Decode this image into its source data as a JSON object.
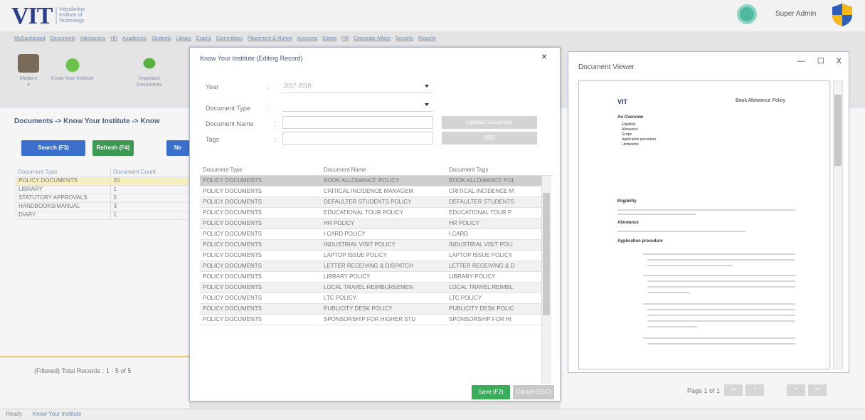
{
  "header": {
    "logo_text": "VIT",
    "logo_sub": [
      "Vidyalankar",
      "Institute of",
      "Technology"
    ],
    "user_name": "Super Admin"
  },
  "menu": [
    "MyDashboard",
    "Documents",
    "Admissions",
    "HR",
    "Academics",
    "Students",
    "Library",
    "Exams",
    "Committees",
    "Placement & Alumni",
    "Accounts",
    "Stores",
    "FM",
    "Corporate Affairs",
    "Security",
    "Reports"
  ],
  "ribbon": [
    {
      "label": "Masters",
      "sub": "▾",
      "icon": "masters-icon"
    },
    {
      "label": "Know Your Institute",
      "icon": "globe-icon"
    },
    {
      "label": "Important Documents",
      "icon": "leaf-icon"
    }
  ],
  "left": {
    "breadcrumb": "Documents -> Know Your Institute -> Know",
    "search_label": "Search (F3)",
    "refresh_label": "Refresh (F4)",
    "new_label": "Ne",
    "table_headers": [
      "Document Type",
      "Document Count"
    ],
    "rows": [
      {
        "type": "POLICY DOCUMENTS",
        "count": "20"
      },
      {
        "type": "LIBRARY",
        "count": "1"
      },
      {
        "type": "STATUTORY APPROVALS",
        "count": "5"
      },
      {
        "type": "HANDBOOKS/MANUAL",
        "count": "3"
      },
      {
        "type": "DIARY",
        "count": "1"
      }
    ],
    "total_records": "(Filtered) Total Records : 1 - 5 of 5"
  },
  "status": {
    "ready": "Ready",
    "page": "Know Your Institute"
  },
  "modal": {
    "title": "Know Your Institute (Editing Record)",
    "close": "×",
    "year_label": "Year",
    "year_value": "2017-2018",
    "doctype_label": "Document Type",
    "docname_label": "Document Name",
    "tags_label": "Tags",
    "colon": ":",
    "upload_label": "Upload Document",
    "add_label": "ADD",
    "grid_headers": [
      "Document Type",
      "Document Name",
      "Document Tags"
    ],
    "grid_rows": [
      {
        "type": "POLICY DOCUMENTS",
        "name": "BOOK ALLOWANCE POLICY",
        "tags": "BOOK ALLOWANCE POL"
      },
      {
        "type": "POLICY DOCUMENTS",
        "name": "CRITICAL INCIDENCE MANAGEM",
        "tags": "CRITICAL INCIDENCE M"
      },
      {
        "type": "POLICY DOCUMENTS",
        "name": "DEFAULTER STUDENTS POLICY",
        "tags": "DEFAULTER STUDENTS"
      },
      {
        "type": "POLICY DOCUMENTS",
        "name": "EDUCATIONAL TOUR POLICY",
        "tags": "EDUCATIONAL TOUR P"
      },
      {
        "type": "POLICY DOCUMENTS",
        "name": "HR POLICY",
        "tags": "HR POLICY"
      },
      {
        "type": "POLICY DOCUMENTS",
        "name": "I CARD POLICY",
        "tags": "I CARD"
      },
      {
        "type": "POLICY DOCUMENTS",
        "name": "INDUSTRIAL VISIT POLICY",
        "tags": "INDUSTRIAL VISIT POLI"
      },
      {
        "type": "POLICY DOCUMENTS",
        "name": "LAPTOP ISSUE POLICY",
        "tags": "LAPTOP ISSUE POLICY"
      },
      {
        "type": "POLICY DOCUMENTS",
        "name": "LETTER RECEIVING & DISPATCH",
        "tags": "LETTER RECEIVING & D"
      },
      {
        "type": "POLICY DOCUMENTS",
        "name": "LIBRARY POLICY",
        "tags": "LIBRARY POLICY"
      },
      {
        "type": "POLICY DOCUMENTS",
        "name": "LOCAL TRAVEL REIMBURSEMEN",
        "tags": "LOCAL TRAVEL REIMBL"
      },
      {
        "type": "POLICY DOCUMENTS",
        "name": "LTC POLICY",
        "tags": "LTC POLICY"
      },
      {
        "type": "POLICY DOCUMENTS",
        "name": "PUBLICITY DESK POLICY",
        "tags": "PUBLICITY DESK POLIC"
      },
      {
        "type": "POLICY DOCUMENTS",
        "name": "SPONSORSHIP FOR HIGHER STU",
        "tags": "SPONSORSHIP FOR HI"
      }
    ],
    "save_label": "Save (F2)",
    "cancel_label": "Cancel (ESC)"
  },
  "viewer": {
    "title": "Document Viewer",
    "minimize": "—",
    "maximize": "☐",
    "close": "X",
    "doc": {
      "logo": "VIT",
      "title": "Book Allowance Policy",
      "overview": "An Overview",
      "bullets": [
        "Eligibility",
        "Allowance",
        "Scope",
        "Application procedure",
        "Limitations"
      ],
      "eligibility_head": "Eligibility",
      "allowance_head": "Allowance",
      "procedure_head": "Application procedure"
    },
    "page_text": "Page 1 of 1",
    "pager": [
      "<<",
      "<",
      ">",
      ">>"
    ]
  }
}
